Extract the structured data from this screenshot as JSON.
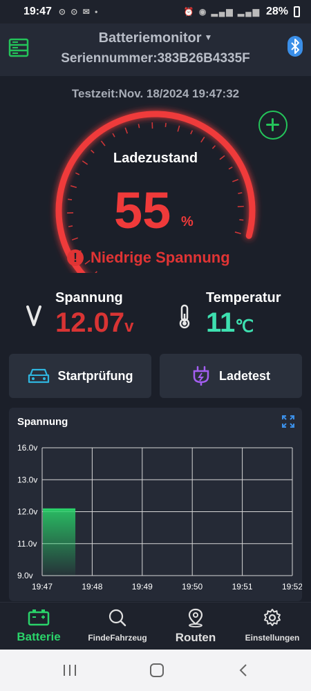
{
  "status_bar": {
    "time": "19:47",
    "battery": "28%"
  },
  "header": {
    "title": "Batteriemonitor",
    "serial": "Seriennummer:383B26B4335F"
  },
  "test_time": "Testzeit:Nov. 18/2024 19:47:32",
  "gauge": {
    "label": "Ladezustand",
    "value": "55",
    "unit": "%",
    "level_percent": 55,
    "warning": "Niedrige Spannung",
    "color": "#ef3a3a"
  },
  "voltage": {
    "label": "Spannung",
    "value": "12.07",
    "unit": "v",
    "color": "#d83434"
  },
  "temperature": {
    "label": "Temperatur",
    "value": "11",
    "unit": "℃",
    "color": "#3ee0b0"
  },
  "actions": {
    "start_check": "Startprüfung",
    "charge_test": "Ladetest"
  },
  "chart_data": {
    "type": "bar",
    "title": "Spannung",
    "y_tick_labels": [
      "16.0v",
      "13.0v",
      "12.0v",
      "11.0v",
      "9.0v"
    ],
    "y_tick_values": [
      16.0,
      13.0,
      12.0,
      11.0,
      9.0
    ],
    "x_tick_labels": [
      "19:47",
      "19:48",
      "19:49",
      "19:50",
      "19:51",
      "19:52"
    ],
    "categories": [
      "19:47"
    ],
    "values": [
      12.07
    ],
    "bar_color": "#2ad36a",
    "grid": true
  },
  "nav": {
    "items": [
      {
        "label": "Batterie",
        "icon": "battery-icon",
        "active": true
      },
      {
        "label": "FindeFahrzeug",
        "icon": "search-car-icon",
        "active": false
      },
      {
        "label": "Routen",
        "icon": "location-pin-icon",
        "active": false
      },
      {
        "label": "Einstellungen",
        "icon": "gear-icon",
        "active": false
      }
    ],
    "active_color": "#2ad36a"
  }
}
